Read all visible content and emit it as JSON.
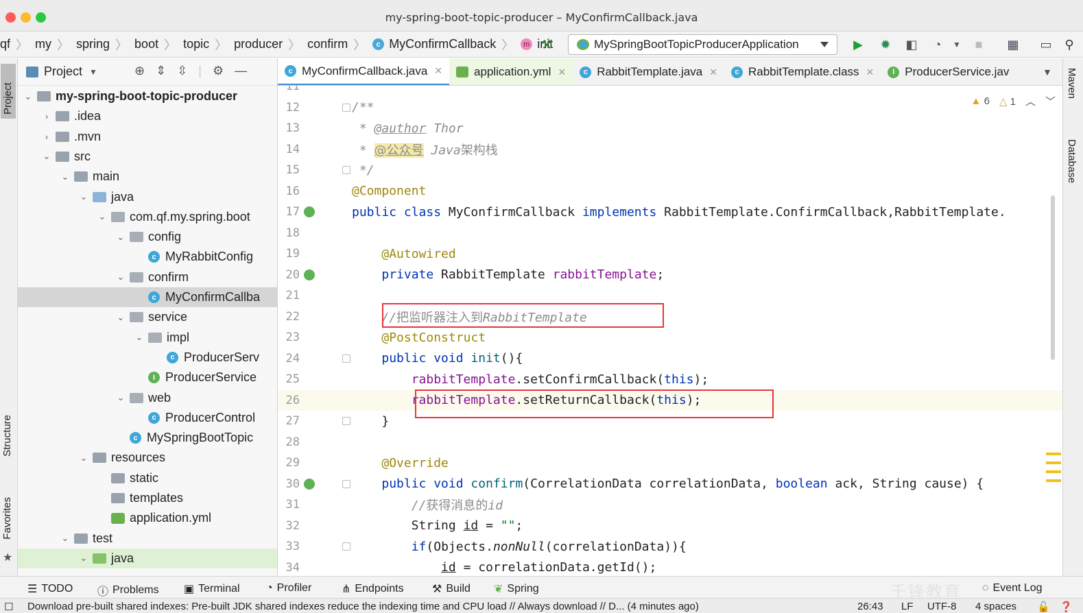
{
  "window": {
    "title": "my-spring-boot-topic-producer – MyConfirmCallback.java"
  },
  "breadcrumbs": [
    "qf",
    "my",
    "spring",
    "boot",
    "topic",
    "producer",
    "confirm",
    "MyConfirmCallback",
    "init"
  ],
  "run_config": {
    "label": "MySpringBootTopicProducerApplication"
  },
  "project_panel": {
    "title": "Project",
    "tree": [
      {
        "label": "my-spring-boot-topic-producer",
        "depth": 0,
        "kind": "module",
        "open": true
      },
      {
        "label": ".idea",
        "depth": 1,
        "kind": "folder",
        "open": false
      },
      {
        "label": ".mvn",
        "depth": 1,
        "kind": "folder",
        "open": false
      },
      {
        "label": "src",
        "depth": 1,
        "kind": "folder",
        "open": true
      },
      {
        "label": "main",
        "depth": 2,
        "kind": "folder",
        "open": true
      },
      {
        "label": "java",
        "depth": 3,
        "kind": "src-folder",
        "open": true
      },
      {
        "label": "com.qf.my.spring.boot",
        "depth": 4,
        "kind": "package",
        "open": true
      },
      {
        "label": "config",
        "depth": 5,
        "kind": "package",
        "open": true
      },
      {
        "label": "MyRabbitConfig",
        "depth": 6,
        "kind": "class"
      },
      {
        "label": "confirm",
        "depth": 5,
        "kind": "package",
        "open": true
      },
      {
        "label": "MyConfirmCallba",
        "depth": 6,
        "kind": "class",
        "selected": true
      },
      {
        "label": "service",
        "depth": 5,
        "kind": "package",
        "open": true
      },
      {
        "label": "impl",
        "depth": 6,
        "kind": "package",
        "open": true
      },
      {
        "label": "ProducerServ",
        "depth": 7,
        "kind": "class"
      },
      {
        "label": "ProducerService",
        "depth": 6,
        "kind": "interface"
      },
      {
        "label": "web",
        "depth": 5,
        "kind": "package",
        "open": true
      },
      {
        "label": "ProducerControl",
        "depth": 6,
        "kind": "class"
      },
      {
        "label": "MySpringBootTopic",
        "depth": 5,
        "kind": "boot"
      },
      {
        "label": "resources",
        "depth": 3,
        "kind": "res-folder",
        "open": true
      },
      {
        "label": "static",
        "depth": 4,
        "kind": "folder"
      },
      {
        "label": "templates",
        "depth": 4,
        "kind": "folder"
      },
      {
        "label": "application.yml",
        "depth": 4,
        "kind": "yml"
      },
      {
        "label": "test",
        "depth": 2,
        "kind": "folder",
        "open": true
      },
      {
        "label": "java",
        "depth": 3,
        "kind": "test-folder",
        "open": true,
        "highlight": true
      }
    ]
  },
  "tabs": [
    {
      "label": "MyConfirmCallback.java",
      "kind": "class",
      "active": true
    },
    {
      "label": "application.yml",
      "kind": "yml"
    },
    {
      "label": "RabbitTemplate.java",
      "kind": "class"
    },
    {
      "label": "RabbitTemplate.class",
      "kind": "class"
    },
    {
      "label": "ProducerService.jav",
      "kind": "interface"
    }
  ],
  "inspections": {
    "warnings": "6",
    "weak_warnings": "1"
  },
  "code_lines": [
    {
      "num": "11",
      "html": ""
    },
    {
      "num": "12",
      "html": "<span class=\"cmt\">/**</span>"
    },
    {
      "num": "13",
      "html": "<span class=\"cmt\"> * <span class=\"tagc\">@author</span> Thor</span>"
    },
    {
      "num": "14",
      "html": "<span class=\"cmt\"> * <span class=\"tagc zh\" style=\"background:#f5e9a8\">@公众号</span> Java<span class=\"zh\">架构栈</span></span>"
    },
    {
      "num": "15",
      "html": "<span class=\"cmt\"> */</span>"
    },
    {
      "num": "16",
      "html": "<span class=\"ann\">@Component</span>"
    },
    {
      "num": "17",
      "html": "<span class=\"kw\">public class</span> MyConfirmCallback <span class=\"kw\">implements</span> RabbitTemplate.ConfirmCallback,RabbitTemplate."
    },
    {
      "num": "18",
      "html": ""
    },
    {
      "num": "19",
      "html": "    <span class=\"ann\">@Autowired</span>"
    },
    {
      "num": "20",
      "html": "    <span class=\"kw\">private</span> RabbitTemplate <span class=\"field\">rabbitTemplate</span>;"
    },
    {
      "num": "21",
      "html": ""
    },
    {
      "num": "22",
      "html": "    <span class=\"cmt\">//<span class=\"zh\">把监听器注入到</span>RabbitTemplate</span>"
    },
    {
      "num": "23",
      "html": "    <span class=\"ann\">@PostConstruct</span>"
    },
    {
      "num": "24",
      "html": "    <span class=\"kw\">public void</span> <span class=\"mth\">init</span>(){"
    },
    {
      "num": "25",
      "html": "        <span class=\"field\">rabbitTemplate</span>.setConfirmCallback(<span class=\"kw\">this</span>);"
    },
    {
      "num": "26",
      "html": "        <span class=\"field\">rabbitTemplate</span>.setReturnCallback(<span class=\"kw\">this</span>);"
    },
    {
      "num": "27",
      "html": "    }"
    },
    {
      "num": "28",
      "html": ""
    },
    {
      "num": "29",
      "html": "    <span class=\"ann\">@Override</span>"
    },
    {
      "num": "30",
      "html": "    <span class=\"kw\">public void</span> <span class=\"mth\">confirm</span>(CorrelationData correlationData, <span class=\"kw\">boolean</span> ack, String cause) {"
    },
    {
      "num": "31",
      "html": "        <span class=\"cmt\">//<span class=\"zh\">获得消息的</span>id</span>"
    },
    {
      "num": "32",
      "html": "        String <span style=\"text-decoration:underline\">id</span> = <span class=\"str\">\"\"</span>;"
    },
    {
      "num": "33",
      "html": "        <span class=\"kw\">if</span>(Objects.<i>nonNull</i>(correlationData)){"
    },
    {
      "num": "34",
      "html": "            <span style=\"text-decoration:underline\">id</span> = correlationData.getId();"
    }
  ],
  "right_tabs": [
    "Maven",
    "Database"
  ],
  "left_tabs": [
    "Project",
    "Structure",
    "Favorites"
  ],
  "bottom_tools": [
    "TODO",
    "Problems",
    "Terminal",
    "Profiler",
    "Endpoints",
    "Build",
    "Spring",
    "Event Log"
  ],
  "watermark": "千锋教育",
  "status": {
    "message": "Download pre-built shared indexes: Pre-built JDK shared indexes reduce the indexing time and CPU load // Always download // D... (4 minutes ago)",
    "position": "26:43",
    "line_sep": "LF",
    "encoding": "UTF-8",
    "indent": "4 spaces"
  }
}
